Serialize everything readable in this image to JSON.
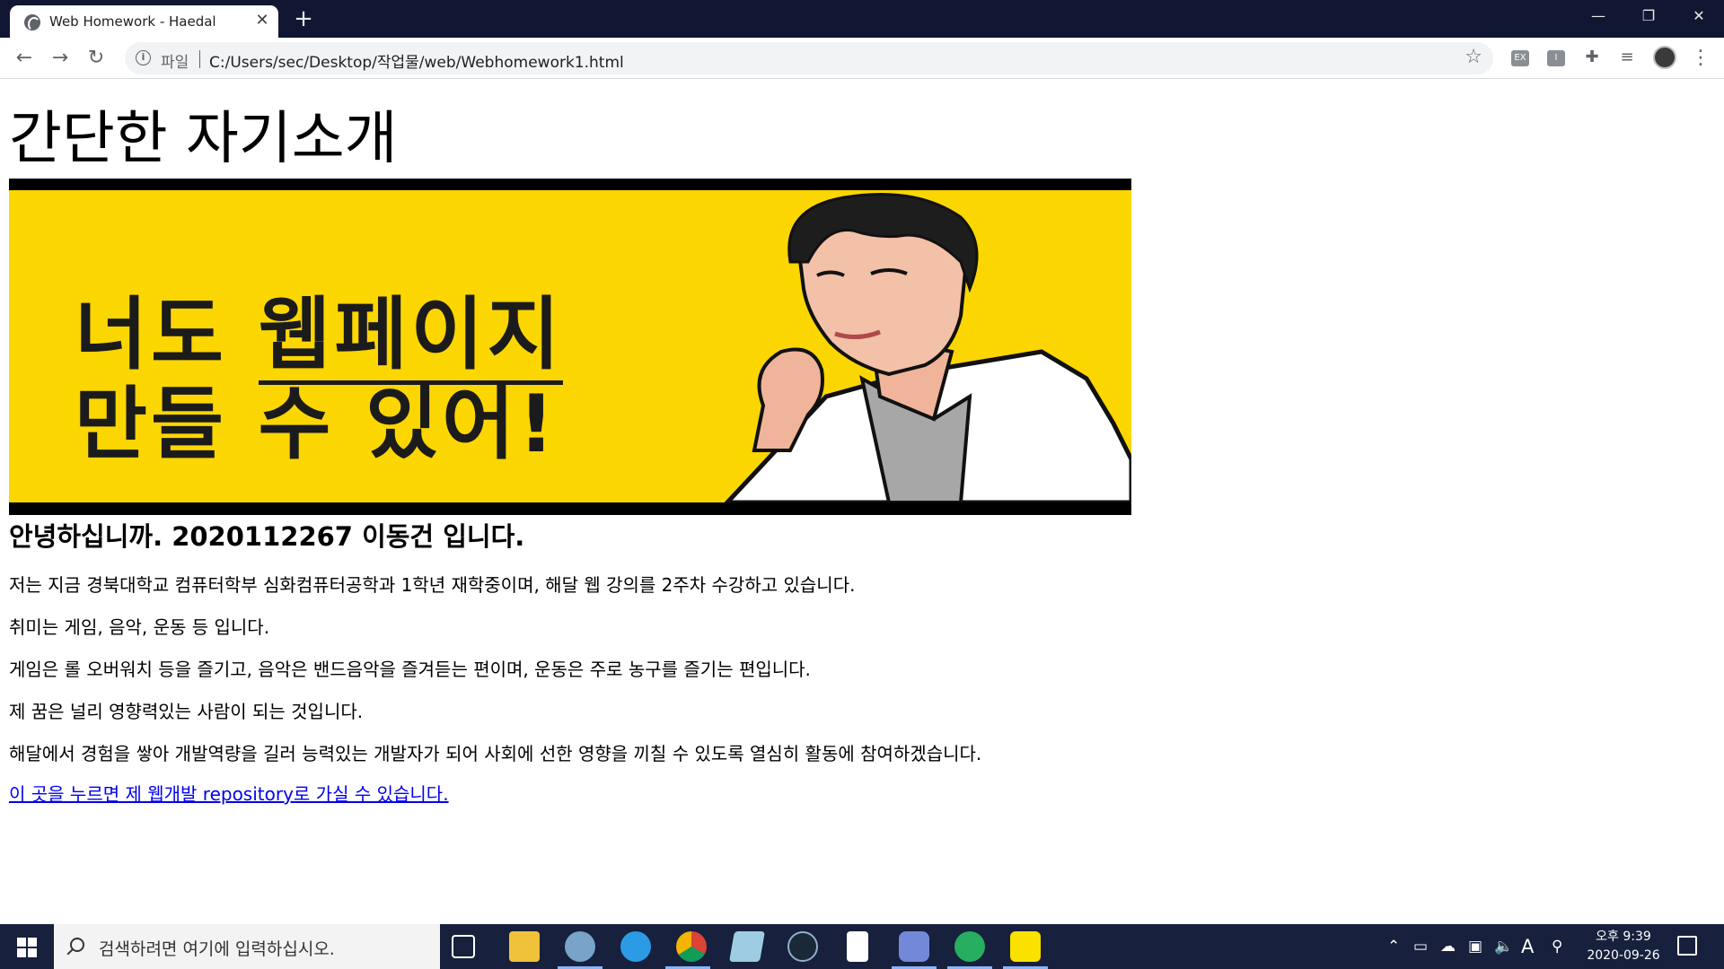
{
  "browser": {
    "tab_title": "Web Homework - Haedal",
    "tab_close": "✕",
    "new_tab": "+",
    "window_controls": {
      "minimize": "—",
      "restore": "❐",
      "close": "✕"
    },
    "url_scheme": "파일",
    "url": "C:/Users/sec/Desktop/작업물/web/Webhomework1.html",
    "extensions": [
      "EX",
      "I"
    ]
  },
  "page": {
    "title": "간단한 자기소개",
    "banner": {
      "line1_plain": "너도 ",
      "line1_strong": "웹페이지",
      "line2": "만들 수 있어!"
    },
    "greeting": "안녕하십니까. 2020112267 이동건 입니다.",
    "paragraphs": [
      "저는 지금 경북대학교 컴퓨터학부 심화컴퓨터공학과 1학년 재학중이며, 해달 웹 강의를 2주차 수강하고 있습니다.",
      "취미는 게임, 음악, 운동 등 입니다.",
      "게임은 롤 오버워치 등을 즐기고, 음악은 밴드음악을 즐겨듣는 편이며, 운동은 주로 농구를 즐기는 편입니다.",
      "제 꿈은 널리 영향력있는 사람이 되는 것입니다.",
      "해달에서 경험을 쌓아 개발역량을 길러 능력있는 개발자가 되어 사회에 선한 영향을 끼칠 수 있도록 열심히 활동에 참여하겠습니다."
    ],
    "repo_link": "이 곳을 누르면 제 웹개발 repository로 가실 수 있습니다."
  },
  "taskbar": {
    "search_placeholder": "검색하려면 여기에 입력하십시오.",
    "ime": "A",
    "time": "오후 9:39",
    "date": "2020-09-26"
  },
  "colors": {
    "titlebar": "#111733",
    "banner_yellow": "#fcd600",
    "link": "#0000ee",
    "taskbar": "#17203d"
  }
}
